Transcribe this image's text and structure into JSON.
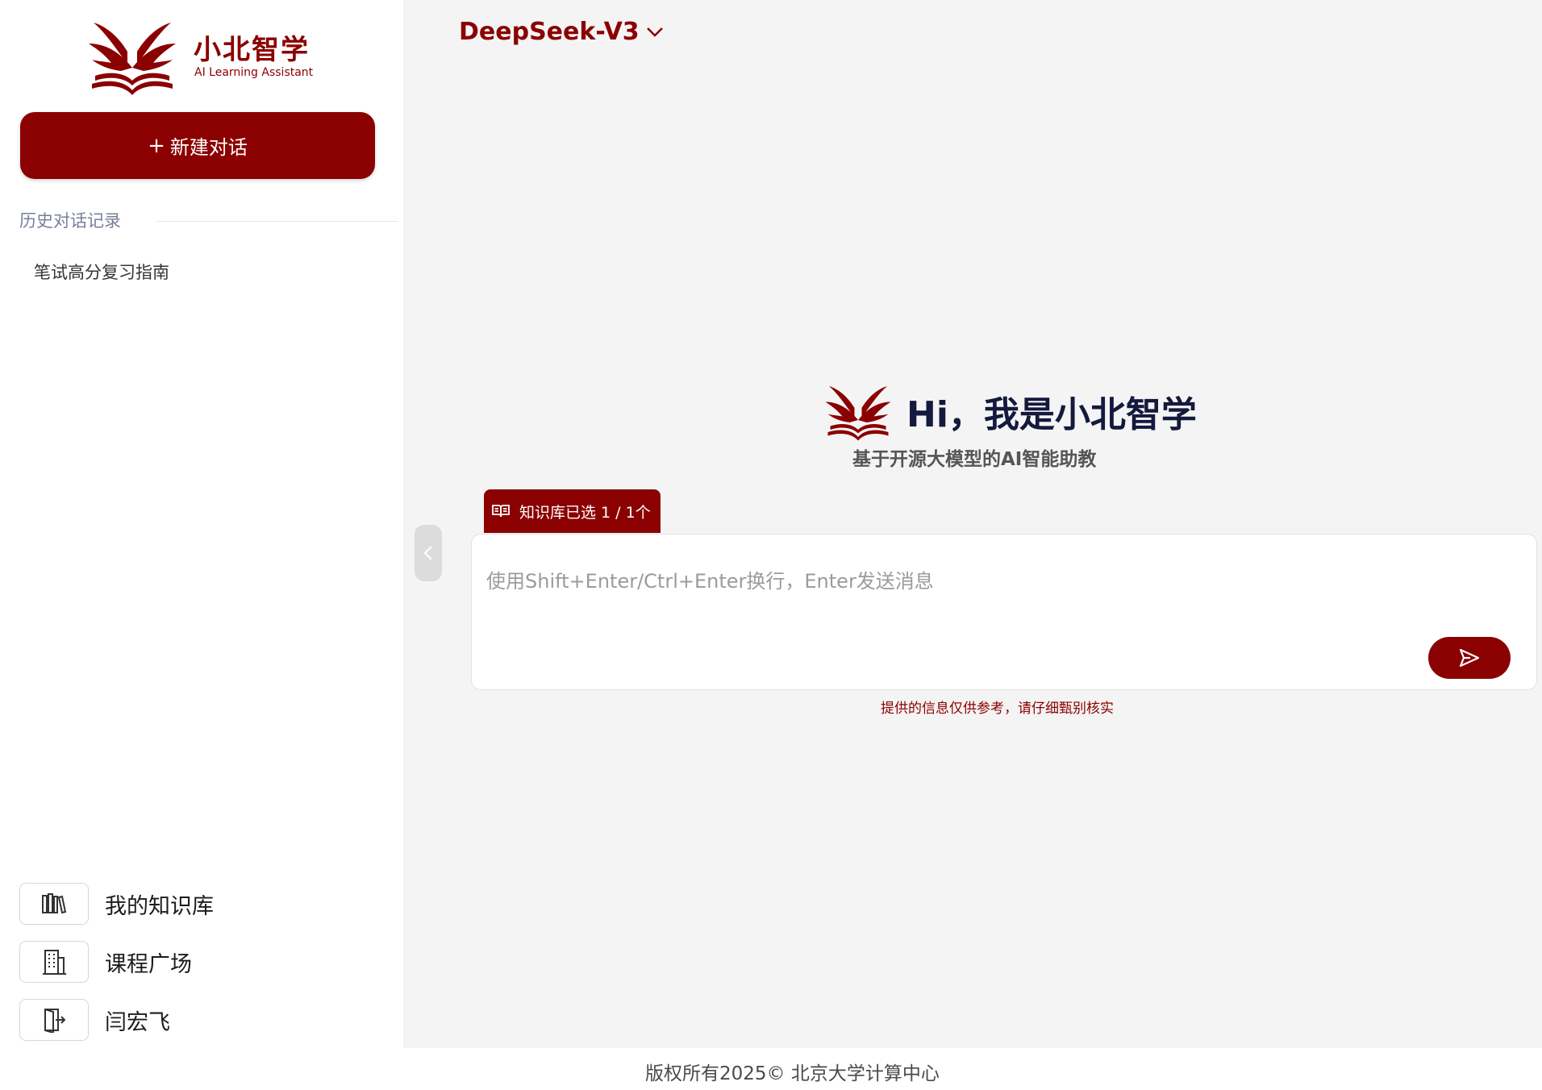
{
  "brand": {
    "name": "小北智学",
    "subtitle": "AI Learning Assistant",
    "accent_color": "#8b0000",
    "logo_icon": "winged-book-logo"
  },
  "sidebar": {
    "new_chat": {
      "plus": "+",
      "label": "新建对话"
    },
    "history_heading": "历史对话记录",
    "history_items": [
      "笔试高分复习指南"
    ],
    "nav": [
      {
        "icon": "bookshelf-icon",
        "label": "我的知识库"
      },
      {
        "icon": "building-icon",
        "label": "课程广场"
      },
      {
        "icon": "logout-icon",
        "label": "闫宏飞"
      }
    ]
  },
  "main": {
    "model_selector": "DeepSeek-V3",
    "greeting_title": "Hi，我是小北智学",
    "greeting_subtitle": "基于开源大模型的AI智能助教",
    "kb_chip": "知识库已选 1 / 1个",
    "input_placeholder": "使用Shift+Enter/Ctrl+Enter换行，Enter发送消息",
    "disclaimer": "提供的信息仅供参考，请仔细甄别核实"
  },
  "footer": {
    "copyright": "版权所有2025© 北京大学计算中心"
  }
}
